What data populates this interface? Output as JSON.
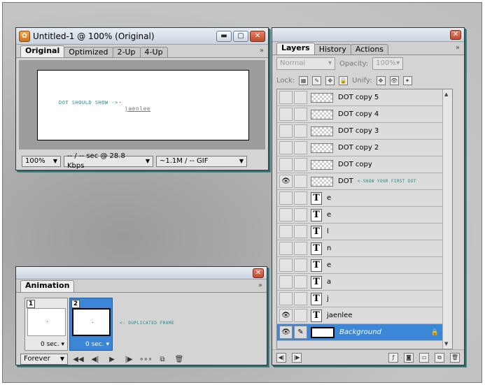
{
  "doc_window": {
    "title": "Untitled-1 @ 100% (Original)",
    "tabs": [
      "Original",
      "Optimized",
      "2-Up",
      "4-Up"
    ],
    "more": "»",
    "canvas_annotation": "DOT SHOULD SHOW ->",
    "canvas_name": "jaenlee",
    "zoom": "100%",
    "speed": "-- / -- sec @ 28.8 Kbps",
    "size_format": "~1.1M / -- GIF"
  },
  "layers_panel": {
    "tabs": [
      "Layers",
      "History",
      "Actions"
    ],
    "more": "»",
    "blend_mode": "Normal",
    "opacity_label": "Opacity:",
    "opacity_value": "100%",
    "lock_label": "Lock:",
    "unify_label": "Unify:",
    "layers": [
      {
        "name": "DOT copy 5",
        "kind": "raster",
        "visible": false
      },
      {
        "name": "DOT copy 4",
        "kind": "raster",
        "visible": false
      },
      {
        "name": "DOT copy 3",
        "kind": "raster",
        "visible": false
      },
      {
        "name": "DOT copy 2",
        "kind": "raster",
        "visible": false
      },
      {
        "name": "DOT copy",
        "kind": "raster",
        "visible": false
      },
      {
        "name": "DOT",
        "kind": "raster",
        "visible": true,
        "annotation": "<-SHOW YOUR FIRST DOT"
      },
      {
        "name": "e",
        "kind": "text",
        "visible": false
      },
      {
        "name": "e",
        "kind": "text",
        "visible": false
      },
      {
        "name": "l",
        "kind": "text",
        "visible": false
      },
      {
        "name": "n",
        "kind": "text",
        "visible": false
      },
      {
        "name": "e",
        "kind": "text",
        "visible": false
      },
      {
        "name": "a",
        "kind": "text",
        "visible": false
      },
      {
        "name": "j",
        "kind": "text",
        "visible": false
      },
      {
        "name": "jaenlee",
        "kind": "text",
        "visible": true
      },
      {
        "name": "Background",
        "kind": "background",
        "visible": true,
        "selected": true
      }
    ]
  },
  "animation_panel": {
    "tab": "Animation",
    "more": "»",
    "frames": [
      {
        "number": "1",
        "delay": "0 sec."
      },
      {
        "number": "2",
        "delay": "0 sec.",
        "selected": true
      }
    ],
    "annotation": "<- DUPLICATED FRAME",
    "loop": "Forever"
  },
  "colors": {
    "selection": "#3b86d7",
    "annotation_teal": "#1f8a8a"
  }
}
